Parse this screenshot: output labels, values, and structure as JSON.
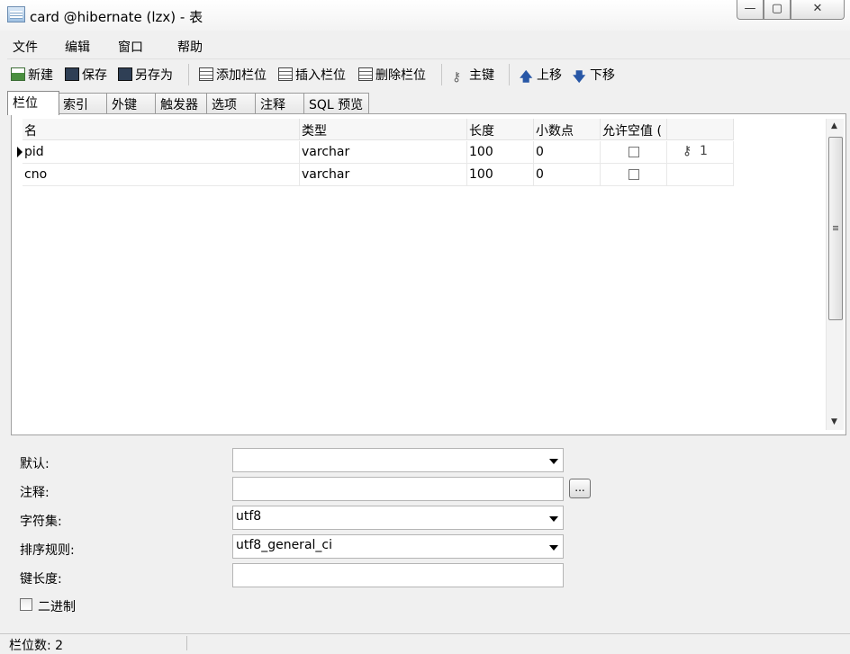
{
  "window": {
    "title": "card @hibernate (lzx) - 表",
    "controls": {
      "minimize": "—",
      "maximize": "▢",
      "close": "✕"
    }
  },
  "menu": [
    "文件",
    "编辑",
    "窗口",
    "帮助"
  ],
  "toolbar": {
    "new": "新建",
    "save": "保存",
    "save_as": "另存为",
    "add_field": "添加栏位",
    "insert_field": "插入栏位",
    "delete_field": "删除栏位",
    "primary_key": "主键",
    "move_up": "上移",
    "move_down": "下移"
  },
  "tabs": [
    "栏位",
    "索引",
    "外键",
    "触发器",
    "选项",
    "注释",
    "SQL 预览"
  ],
  "active_tab": "栏位",
  "grid": {
    "columns": [
      "名",
      "类型",
      "长度",
      "小数点",
      "允许空值 (",
      ""
    ],
    "rows": [
      {
        "name": "pid",
        "type": "varchar",
        "length": "100",
        "decimal": "0",
        "nullable": false,
        "key": "1",
        "current": true
      },
      {
        "name": "cno",
        "type": "varchar",
        "length": "100",
        "decimal": "0",
        "nullable": false,
        "key": "",
        "current": false
      }
    ]
  },
  "properties": {
    "default_label": "默认:",
    "default_value": "",
    "comment_label": "注释:",
    "comment_value": "",
    "comment_button": "...",
    "charset_label": "字符集:",
    "charset_value": "utf8",
    "collation_label": "排序规则:",
    "collation_value": "utf8_general_ci",
    "key_length_label": "键长度:",
    "key_length_value": "",
    "binary_label": "二进制",
    "binary_checked": false
  },
  "status": {
    "field_count": "栏位数: 2"
  },
  "icons": {
    "window": "table-window-icon",
    "new": "new-icon",
    "save": "save-icon",
    "save_as": "save-as-icon",
    "add_field": "add-field-icon",
    "insert_field": "insert-field-icon",
    "delete_field": "delete-field-icon",
    "key": "key-icon",
    "up": "arrow-up-icon",
    "down": "arrow-down-icon"
  }
}
